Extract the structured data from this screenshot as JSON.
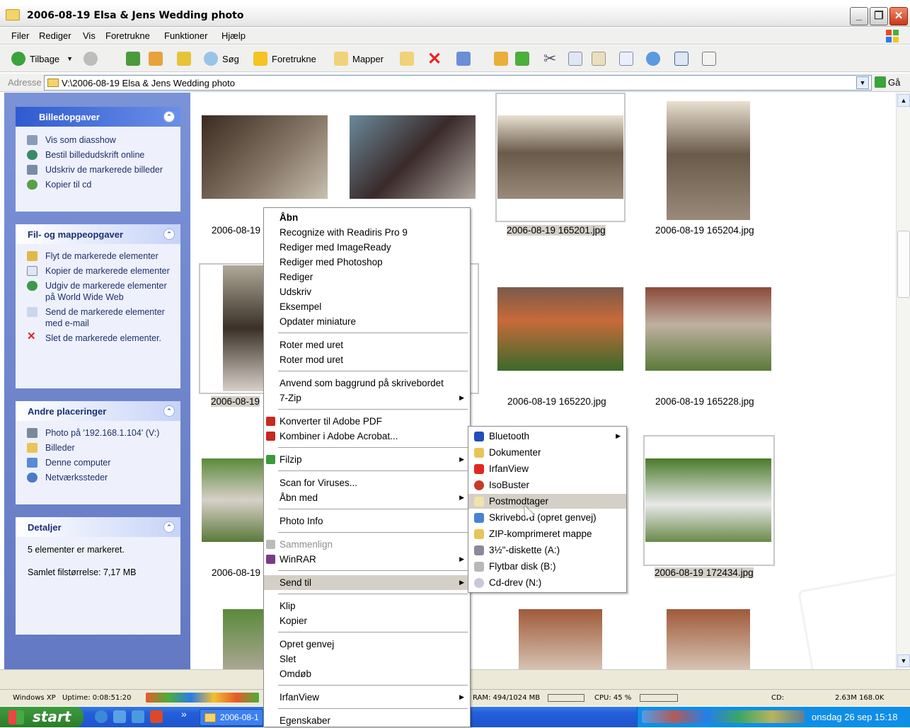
{
  "window": {
    "title": "2006-08-19 Elsa & Jens Wedding photo"
  },
  "menubar": {
    "items": [
      "Filer",
      "Rediger",
      "Vis",
      "Foretrukne",
      "Funktioner",
      "Hjælp"
    ]
  },
  "toolbar": {
    "back": "Tilbage",
    "search": "Søg",
    "favorites": "Foretrukne",
    "folders": "Mapper"
  },
  "address": {
    "label": "Adresse",
    "value": "V:\\2006-08-19 Elsa & Jens Wedding photo",
    "go": "Gå"
  },
  "sidebar": {
    "picture_tasks": {
      "title": "Billedopgaver",
      "items": [
        "Vis som diasshow",
        "Bestil billedudskrift online",
        "Udskriv de markerede billeder",
        "Kopier til cd"
      ]
    },
    "file_tasks": {
      "title": "Fil- og mappeopgaver",
      "items": [
        "Flyt de markerede elementer",
        "Kopier de markerede elementer",
        "Udgiv de markerede elementer på World Wide Web",
        "Send de markerede elementer med e-mail",
        "Slet de markerede elementer."
      ]
    },
    "other_places": {
      "title": "Andre placeringer",
      "items": [
        "Photo på '192.168.1.104' (V:)",
        "Billeder",
        "Denne computer",
        "Netværkssteder"
      ]
    },
    "details": {
      "title": "Detaljer",
      "line1": "5 elementer er markeret.",
      "line2": "Samlet filstørrelse: 7,17 MB"
    }
  },
  "thumbnails": {
    "row1": [
      "2006-08-19",
      "2006-08-19 165201.jpg",
      "2006-08-19 165204.jpg"
    ],
    "row2": [
      "2006-08-19",
      "2006-08-19 165220.jpg",
      "2006-08-19 165228.jpg"
    ],
    "row3": [
      "2006-08-19",
      "2006-08-19 172434.jpg"
    ]
  },
  "context_menu": {
    "items": [
      "Åbn",
      "Recognize with Readiris Pro 9",
      "Rediger med ImageReady",
      "Rediger med Photoshop",
      "Rediger",
      "Udskriv",
      "Eksempel",
      "Opdater miniature",
      "Roter med uret",
      "Roter mod uret",
      "Anvend som baggrund på skrivebordet",
      "7-Zip",
      "Konverter til Adobe PDF",
      "Kombiner i Adobe Acrobat...",
      "Filzip",
      "Scan for Viruses...",
      "Åbn med",
      "Photo Info",
      "Sammenlign",
      "WinRAR",
      "Send til",
      "Klip",
      "Kopier",
      "Opret genvej",
      "Slet",
      "Omdøb",
      "IrfanView",
      "Egenskaber"
    ]
  },
  "send_to_menu": {
    "items": [
      "Bluetooth",
      "Dokumenter",
      "IrfanView",
      "IsoBuster",
      "Postmodtager",
      "Skrivebord (opret genvej)",
      "ZIP-komprimeret mappe",
      "3½\"-diskette (A:)",
      "Flytbar disk (B:)",
      "Cd-drev (N:)"
    ]
  },
  "infobar": {
    "os": "Windows XP",
    "uptime": "Uptime:  0:08:51:20",
    "ram": "RAM:  494/1024 MB",
    "cpu": "CPU:  45 %",
    "cd": "CD:",
    "net": "2.63M  168.0K"
  },
  "taskbar": {
    "start": "start",
    "task": "2006-08-1",
    "clock": "onsdag 26 sep 15:18"
  }
}
